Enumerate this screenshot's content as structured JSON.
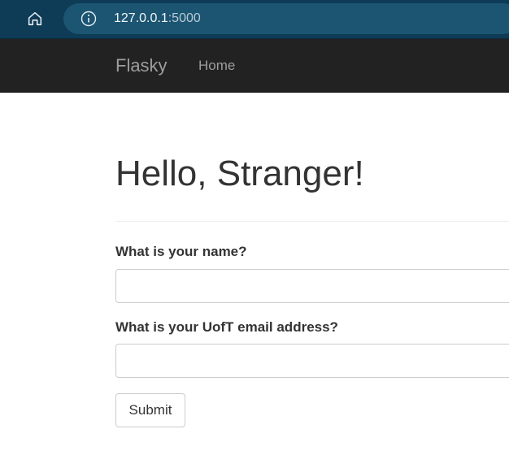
{
  "browser": {
    "home_icon": "home-icon",
    "info_icon": "info-icon",
    "url_host": "127.0.0.1",
    "url_port": ":5000"
  },
  "navbar": {
    "brand": "Flasky",
    "links": [
      {
        "label": "Home"
      }
    ]
  },
  "page": {
    "title": "Hello, Stranger!"
  },
  "form": {
    "name_label": "What is your name?",
    "name_value": "",
    "email_label": "What is your UofT email address?",
    "email_value": "",
    "submit_label": "Submit"
  },
  "colors": {
    "browser_bar": "#0e3b56",
    "address_pill": "#1b5572",
    "navbar_bg": "#222222",
    "navbar_text": "#9d9d9d",
    "body_text": "#333333"
  }
}
